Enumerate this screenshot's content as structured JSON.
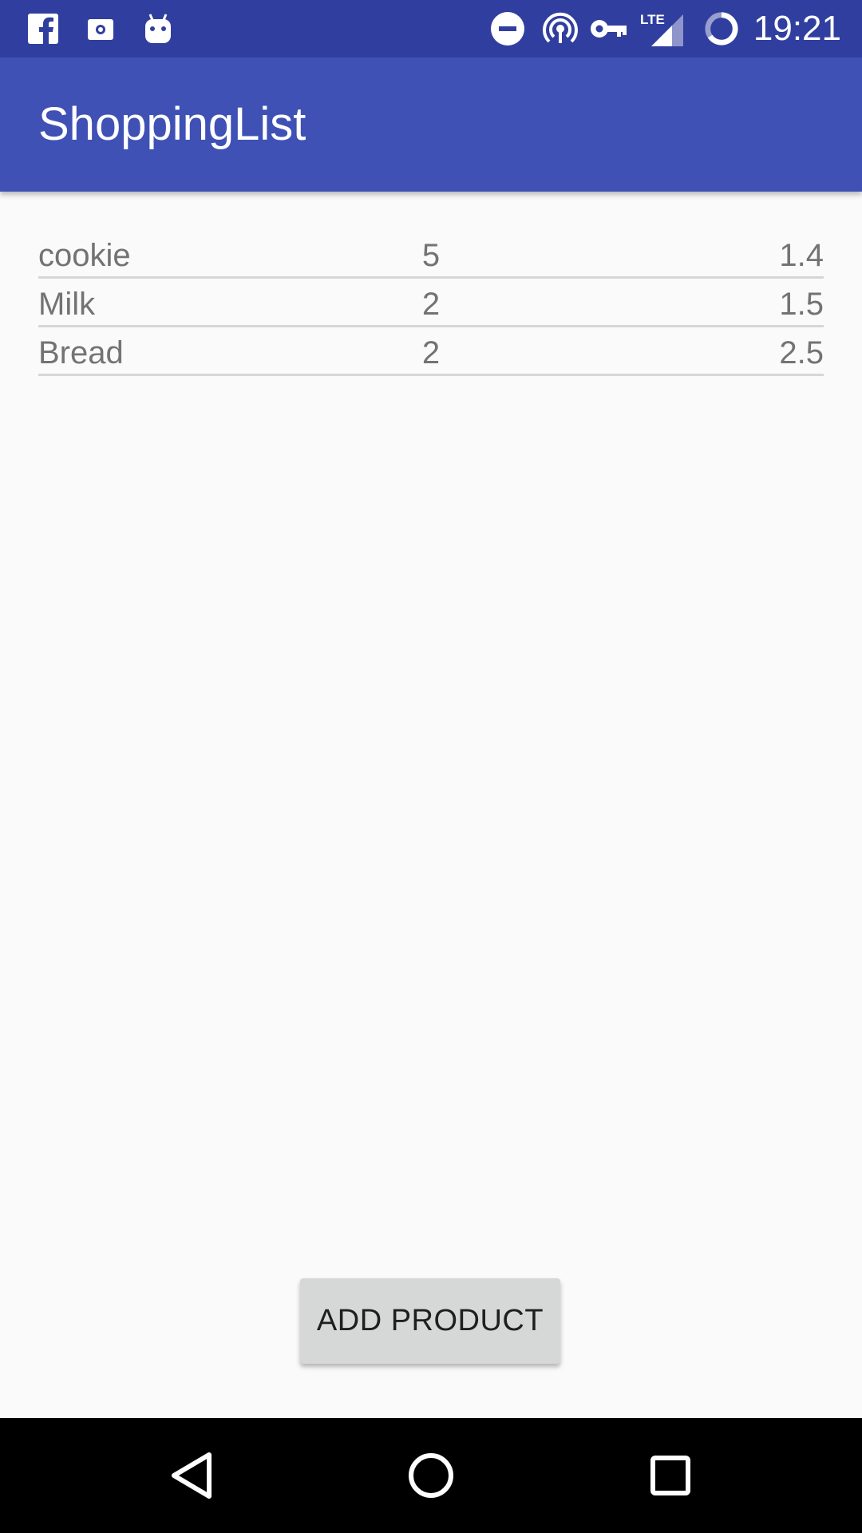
{
  "status_bar": {
    "time": "19:21",
    "left_icons": [
      "facebook-icon",
      "camera-app-icon",
      "android-debug-icon"
    ],
    "right_icons": [
      "do-not-disturb-icon",
      "hotspot-icon",
      "vpn-key-icon",
      "lte-signal-icon",
      "battery-charging-icon"
    ],
    "network_label": "LTE"
  },
  "app_bar": {
    "title": "ShoppingList",
    "color": "#3f51b5",
    "status_color": "#303f9f"
  },
  "products": [
    {
      "name": "cookie",
      "quantity": "5",
      "price": "1.4"
    },
    {
      "name": "Milk",
      "quantity": "2",
      "price": "1.5"
    },
    {
      "name": "Bread",
      "quantity": "2",
      "price": "2.5"
    }
  ],
  "add_button": {
    "label": "ADD PRODUCT"
  },
  "nav_bar": {
    "icons": [
      "back-icon",
      "home-icon",
      "recents-icon"
    ]
  }
}
